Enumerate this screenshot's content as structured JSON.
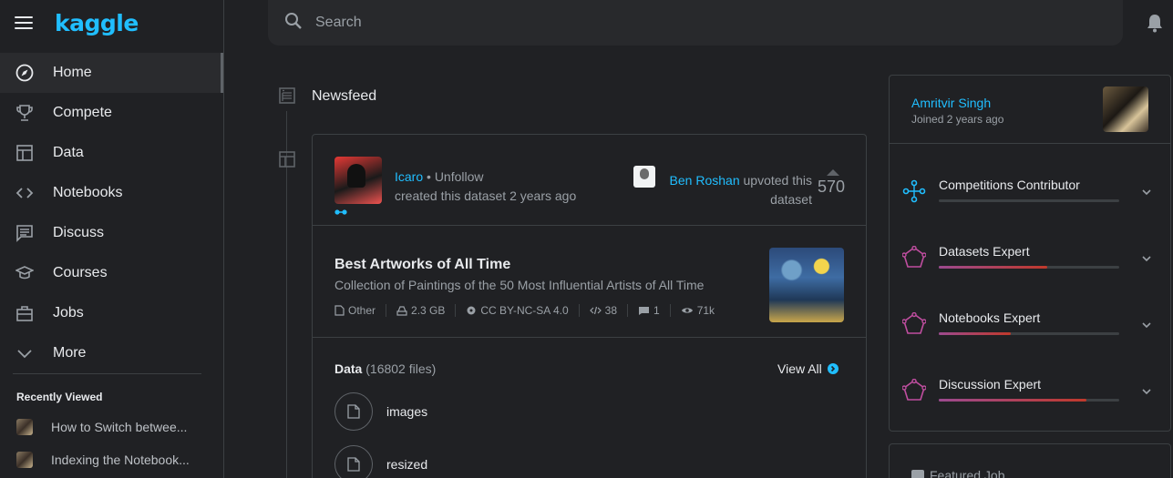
{
  "brand": {
    "logo_text": "kaggle"
  },
  "sidebar": {
    "items": [
      {
        "label": "Home",
        "icon": "compass-icon",
        "active": true
      },
      {
        "label": "Compete",
        "icon": "trophy-icon"
      },
      {
        "label": "Data",
        "icon": "table-icon"
      },
      {
        "label": "Notebooks",
        "icon": "code-icon"
      },
      {
        "label": "Discuss",
        "icon": "comment-icon"
      },
      {
        "label": "Courses",
        "icon": "school-icon"
      },
      {
        "label": "Jobs",
        "icon": "briefcase-icon"
      },
      {
        "label": "More",
        "icon": "chevron-down-icon"
      }
    ],
    "recent_title": "Recently Viewed",
    "recent": [
      {
        "label": "How to Switch betwee..."
      },
      {
        "label": "Indexing the Notebook..."
      }
    ]
  },
  "search": {
    "placeholder": "Search"
  },
  "feed": {
    "title": "Newsfeed",
    "card": {
      "author": "Icaro",
      "bullet": "•",
      "unfollow": "Unfollow",
      "action": "created this dataset 2 years ago",
      "upvoter": "Ben Roshan",
      "upvote_text_1": " upvoted this",
      "upvote_text_2": "dataset",
      "vote_count": "570",
      "dataset": {
        "title": "Best Artworks of All Time",
        "subtitle": "Collection of Paintings of the 50 Most Influential Artists of All Time",
        "meta": {
          "type": "Other",
          "size": "2.3 GB",
          "license": "CC BY-NC-SA 4.0",
          "notebooks": "38",
          "comments": "1",
          "views": "71k"
        }
      },
      "data": {
        "label": "Data",
        "count": " (16802 files)",
        "view_all": "View All",
        "files": [
          {
            "name": "images"
          },
          {
            "name": "resized"
          }
        ]
      }
    }
  },
  "profile": {
    "name": "Amritvir Singh",
    "joined": "Joined 2 years ago",
    "tiers": [
      {
        "label": "Competitions Contributor",
        "progress": 0,
        "color": "#20beff"
      },
      {
        "label": "Datasets Expert",
        "progress": 0.6,
        "color": "#9c4a8f"
      },
      {
        "label": "Notebooks Expert",
        "progress": 0.4,
        "color": "#9c4a8f"
      },
      {
        "label": "Discussion Expert",
        "progress": 0.82,
        "color": "#9c4a8f"
      }
    ],
    "featured": "Featured Job"
  }
}
